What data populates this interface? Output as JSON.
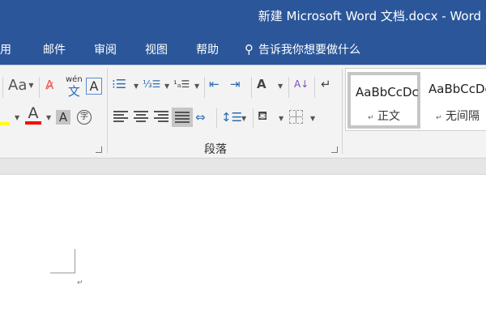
{
  "title": "新建 Microsoft Word 文档.docx  -  Word",
  "tabs": [
    "用",
    "邮件",
    "审阅",
    "视图",
    "帮助"
  ],
  "tell_me": "告诉我你想要做什么",
  "ribbon": {
    "change_case": "Aa",
    "phonetic_top": "wén",
    "phonetic_bottom": "文",
    "char_border": "A",
    "font_color": "A",
    "shading": "A",
    "enclose": "字",
    "paragraph_group": "段落",
    "colors": {
      "highlight": "#ffff00",
      "font_color": "#ff0000"
    }
  },
  "styles": [
    {
      "sample": "AaBbCcDc",
      "name": "正文"
    },
    {
      "sample": "AaBbCcDc",
      "name": "无间隔"
    }
  ],
  "doc": {
    "paragraph_mark": "↵"
  }
}
